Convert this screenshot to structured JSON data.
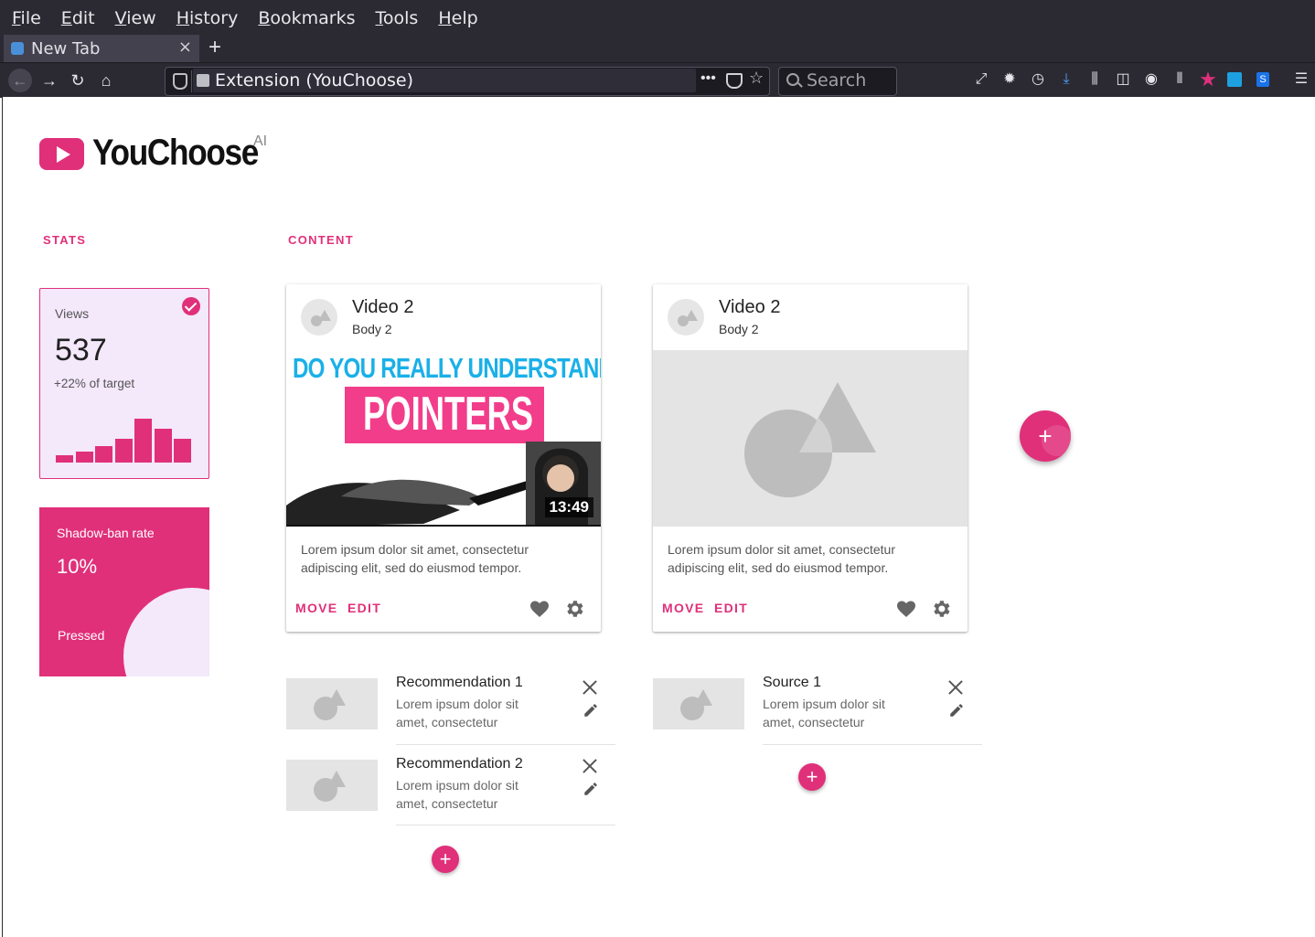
{
  "browser": {
    "menu": [
      "File",
      "Edit",
      "View",
      "History",
      "Bookmarks",
      "Tools",
      "Help"
    ],
    "tab_title": "New Tab",
    "new_tab": "+",
    "tab_close": "×",
    "url": "Extension (YouChoose)",
    "url_dots": "•••",
    "search_placeholder": "Search"
  },
  "app": {
    "name": "YouChoose",
    "suffix": "AI",
    "brand_color": "#e0307a"
  },
  "stats": {
    "heading": "STATS",
    "views": {
      "label": "Views",
      "value": "537",
      "sub": "+22% of target",
      "bars": [
        0.13,
        0.2,
        0.3,
        0.43,
        0.8,
        0.61,
        0.44
      ]
    },
    "shadow_ban": {
      "label": "Shadow-ban rate",
      "value": "10%",
      "state": "Pressed"
    }
  },
  "content": {
    "heading": "CONTENT",
    "cards": [
      {
        "title": "Video 2",
        "body": "Body 2",
        "thumb_headline": "DO YOU REALLY UNDERSTAND",
        "thumb_word": "POINTERS",
        "duration": "13:49",
        "description": "Lorem ipsum dolor sit amet, consectetur adipiscing elit, sed do eiusmod tempor.",
        "move": "MOVE",
        "edit": "EDIT"
      },
      {
        "title": "Video 2",
        "body": "Body 2",
        "description": "Lorem ipsum dolor sit amet, consectetur adipiscing elit, sed do eiusmod tempor.",
        "move": "MOVE",
        "edit": "EDIT"
      }
    ],
    "recommendations": [
      {
        "title": "Recommendation 1",
        "text": "Lorem ipsum dolor sit amet, consectetur"
      },
      {
        "title": "Recommendation 2",
        "text": "Lorem ipsum dolor sit amet, consectetur"
      }
    ],
    "sources": [
      {
        "title": "Source 1",
        "text": "Lorem ipsum dolor sit amet, consectetur"
      }
    ],
    "add_symbol": "+"
  }
}
